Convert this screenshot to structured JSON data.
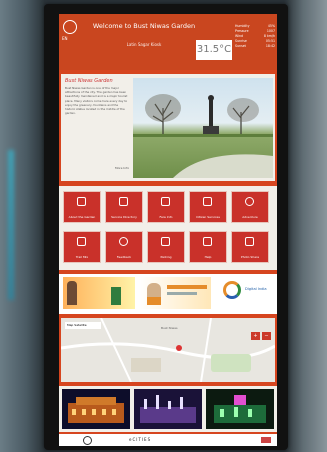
{
  "header": {
    "title": "Welcome to Bust Niwas Garden",
    "subtitle": "Latin Sagar Kiosk",
    "lang": "EN",
    "temperature": "31.5°C",
    "weather": [
      {
        "k": "Humidity",
        "v": "45%"
      },
      {
        "k": "Pressure",
        "v": "1007"
      },
      {
        "k": "Wind",
        "v": "8 km/h"
      },
      {
        "k": "Sunrise",
        "v": "05:51"
      },
      {
        "k": "Sunset",
        "v": "18:42"
      }
    ]
  },
  "welcome": {
    "heading": "Bust Niwas Garden",
    "body": "Bust Niwas Garden is one of the major attractions of the city. The garden has been beautifully maintained and is a major tourist place. Many visitors come here every day to enjoy the greenery, fountains and the historic statue located in the middle of the garden.",
    "more": "More Info"
  },
  "tiles": [
    {
      "label": "About the Garden",
      "icon": "info-icon"
    },
    {
      "label": "Service Directory",
      "icon": "book-icon"
    },
    {
      "label": "Fare Info",
      "icon": "ticket-icon"
    },
    {
      "label": "Citizen Services",
      "icon": "people-icon"
    },
    {
      "label": "Adventure",
      "icon": "map-icon"
    },
    {
      "label": "Trail Mix",
      "icon": "trail-icon"
    },
    {
      "label": "Feedback",
      "icon": "phone-icon"
    },
    {
      "label": "Parking",
      "icon": "parking-icon"
    },
    {
      "label": "Help",
      "icon": "help-icon"
    },
    {
      "label": "Photo Share",
      "icon": "camera-icon"
    }
  ],
  "banners": {
    "third_text": "Digital India"
  },
  "map": {
    "tab": "Map Satellite",
    "label": "Bust Niwas"
  },
  "footer": {
    "text": "eCITIES"
  },
  "colors": {
    "primary": "#c9461f",
    "tile": "#c9312a"
  }
}
